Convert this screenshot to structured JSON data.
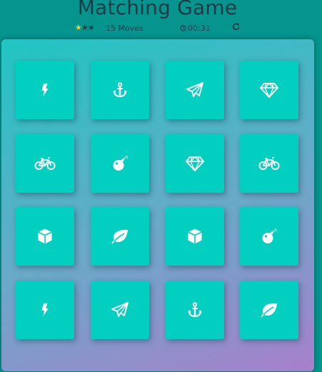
{
  "title": "Matching Game",
  "score": {
    "stars_total": 3,
    "stars_lit": 1,
    "moves_text": "15 Moves",
    "timer_text": "00:31"
  },
  "colors": {
    "background": "#06948f",
    "card": "#02cfbf",
    "star_on": "#f1d11a",
    "text": "#1f3b46"
  },
  "deck": {
    "rows": [
      [
        "bolt-icon",
        "anchor-icon",
        "paper-plane-icon",
        "diamond-icon"
      ],
      [
        "bicycle-icon",
        "bomb-icon",
        "diamond-icon",
        "bicycle-icon"
      ],
      [
        "cube-icon",
        "leaf-icon",
        "cube-icon",
        "bomb-icon"
      ],
      [
        "bolt-icon",
        "paper-plane-icon",
        "anchor-icon",
        "leaf-icon"
      ]
    ]
  }
}
